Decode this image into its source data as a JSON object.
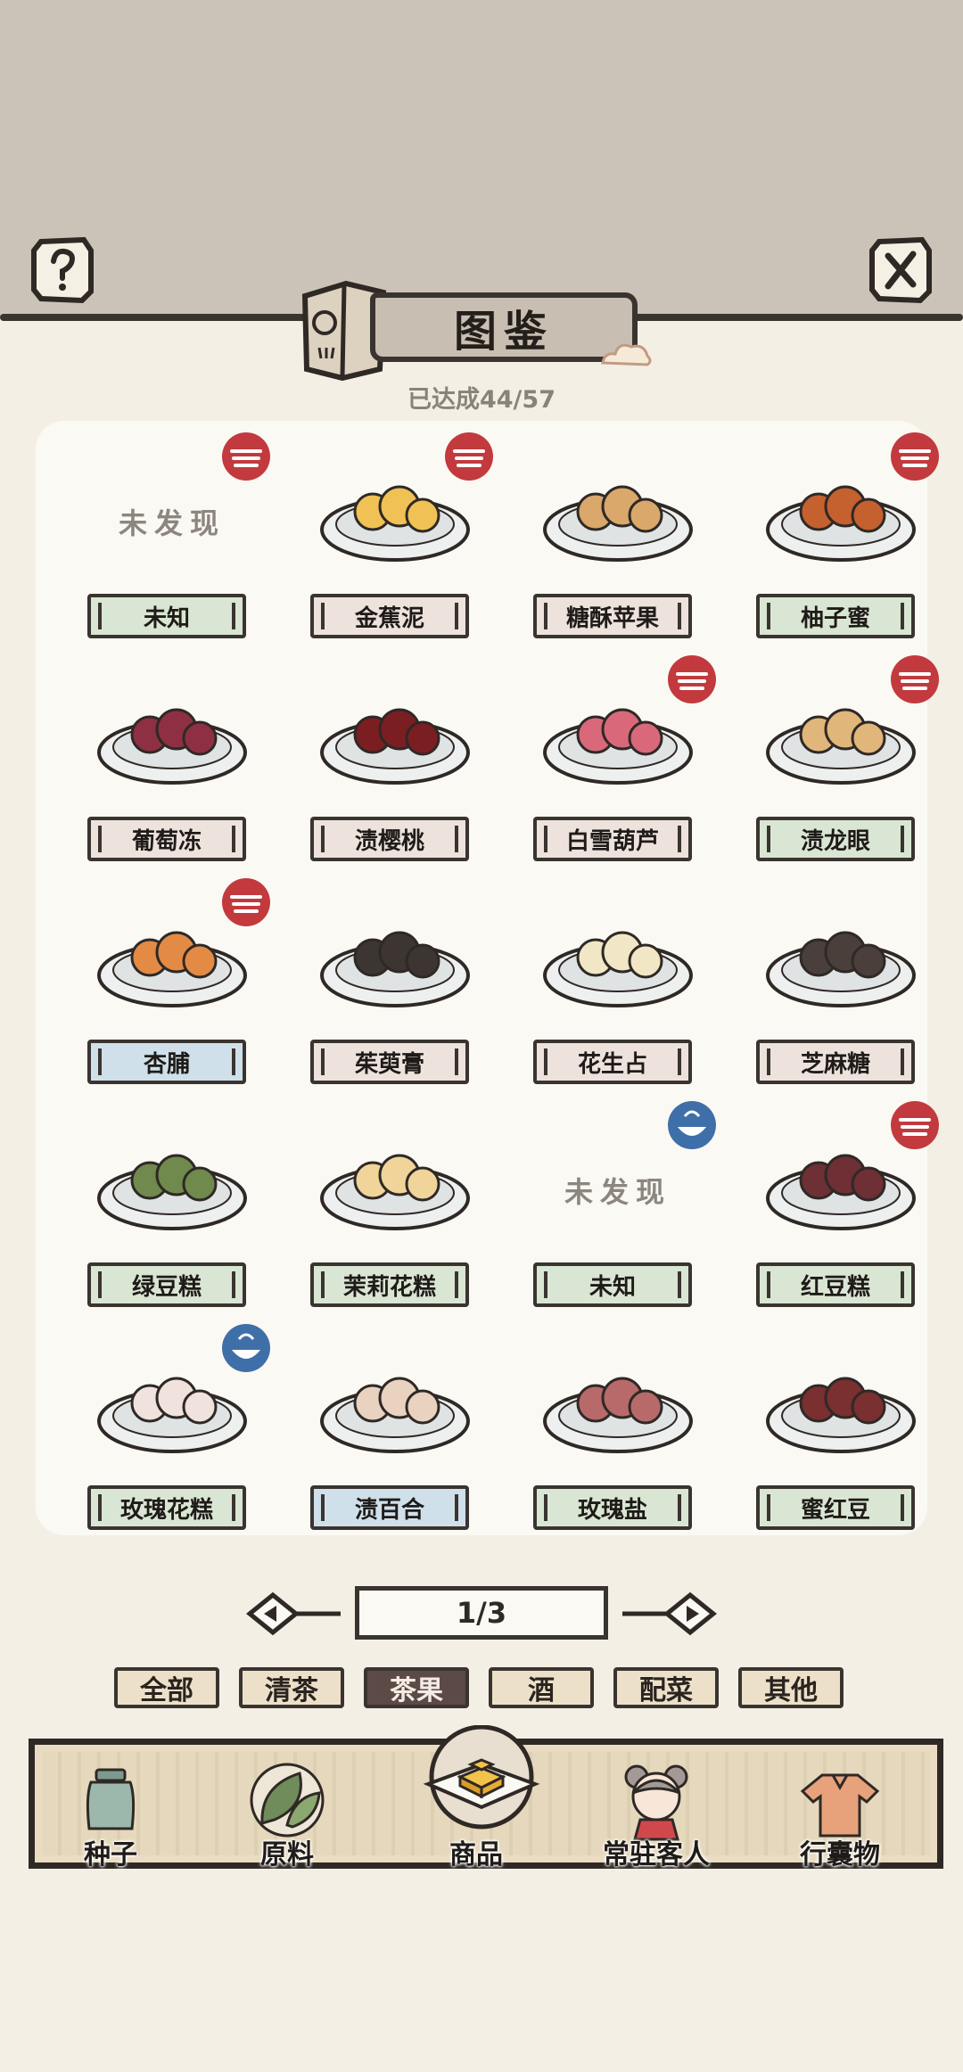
{
  "header": {
    "help_icon": "question-icon",
    "close_icon": "close-icon",
    "title": "图鉴",
    "progress": "已达成44/57"
  },
  "grid": {
    "items": [
      {
        "label": "未知",
        "discovered": false,
        "unknown_text": "未发现",
        "tag_color": "green",
        "badge": "red-ribbon"
      },
      {
        "label": "金蕉泥",
        "discovered": true,
        "tag_color": "pink",
        "badge": "red-ribbon"
      },
      {
        "label": "糖酥苹果",
        "discovered": true,
        "tag_color": "pink",
        "badge": "none"
      },
      {
        "label": "柚子蜜",
        "discovered": true,
        "tag_color": "green",
        "badge": "red-ribbon"
      },
      {
        "label": "葡萄冻",
        "discovered": true,
        "tag_color": "pink",
        "badge": "none"
      },
      {
        "label": "渍樱桃",
        "discovered": true,
        "tag_color": "pink",
        "badge": "none"
      },
      {
        "label": "白雪葫芦",
        "discovered": true,
        "tag_color": "pink",
        "badge": "red-ribbon"
      },
      {
        "label": "渍龙眼",
        "discovered": true,
        "tag_color": "green",
        "badge": "red-ribbon"
      },
      {
        "label": "杏脯",
        "discovered": true,
        "tag_color": "blue",
        "badge": "red-ribbon"
      },
      {
        "label": "茱萸膏",
        "discovered": true,
        "tag_color": "pink",
        "badge": "none"
      },
      {
        "label": "花生占",
        "discovered": true,
        "tag_color": "pink",
        "badge": "none"
      },
      {
        "label": "芝麻糖",
        "discovered": true,
        "tag_color": "pink",
        "badge": "none"
      },
      {
        "label": "绿豆糕",
        "discovered": true,
        "tag_color": "green",
        "badge": "none"
      },
      {
        "label": "茉莉花糕",
        "discovered": true,
        "tag_color": "green",
        "badge": "none"
      },
      {
        "label": "未知",
        "discovered": false,
        "unknown_text": "未发现",
        "tag_color": "green",
        "badge": "blue-bowl"
      },
      {
        "label": "红豆糕",
        "discovered": true,
        "tag_color": "green",
        "badge": "red-ribbon"
      },
      {
        "label": "玫瑰花糕",
        "discovered": true,
        "tag_color": "green",
        "badge": "blue-bowl"
      },
      {
        "label": "渍百合",
        "discovered": true,
        "tag_color": "blue",
        "badge": "none"
      },
      {
        "label": "玫瑰盐",
        "discovered": true,
        "tag_color": "green",
        "badge": "none"
      },
      {
        "label": "蜜红豆",
        "discovered": true,
        "tag_color": "green",
        "badge": "none"
      }
    ]
  },
  "pager": {
    "page": "1/3",
    "prev_icon": "arrow-left-icon",
    "next_icon": "arrow-right-icon"
  },
  "filters": {
    "items": [
      {
        "label": "全部",
        "active": false
      },
      {
        "label": "清茶",
        "active": false
      },
      {
        "label": "茶果",
        "active": true
      },
      {
        "label": "酒",
        "active": false
      },
      {
        "label": "配菜",
        "active": false
      },
      {
        "label": "其他",
        "active": false
      }
    ]
  },
  "nav": {
    "items": [
      {
        "label": "种子",
        "icon": "seed-jar-icon"
      },
      {
        "label": "原料",
        "icon": "tea-leaf-icon"
      },
      {
        "label": "商品",
        "icon": "pastry-plate-icon"
      },
      {
        "label": "常驻客人",
        "icon": "girl-avatar-icon"
      },
      {
        "label": "行囊物",
        "icon": "robe-icon"
      }
    ]
  },
  "colors": {
    "tag_green": "#d9e6d3",
    "tag_pink": "#ede2dc",
    "tag_blue": "#cfe0ea",
    "badge_red": "#c23a3e",
    "badge_blue": "#3f6fa8",
    "active_filter": "#5c4a46"
  }
}
